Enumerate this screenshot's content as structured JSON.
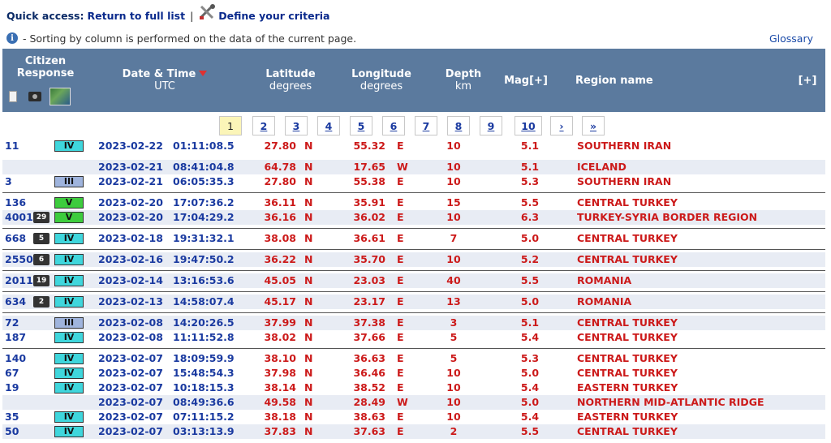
{
  "quick_access": {
    "label": "Quick access:",
    "return_link": "Return to full list",
    "separator": "|",
    "define_link": "Define your criteria"
  },
  "info": {
    "text": "- Sorting by column is performed on the data of the current page."
  },
  "glossary": "Glossary",
  "header": {
    "citizen_line1": "Citizen",
    "citizen_line2": "Response",
    "date_time": "Date & Time",
    "utc": "UTC",
    "latitude": "Latitude",
    "latitude_unit": "degrees",
    "longitude": "Longitude",
    "longitude_unit": "degrees",
    "depth": "Depth",
    "depth_unit": "km",
    "mag": "Mag[+]",
    "region": "Region name",
    "more": "[+]"
  },
  "pager": [
    "1",
    "2",
    "3",
    "4",
    "5",
    "6",
    "7",
    "8",
    "9",
    "10",
    "›",
    "»"
  ],
  "pager_current": "1",
  "colors": {
    "header_bg": "#5b7a9e",
    "intensity_II": "#4aa3e0",
    "intensity_III": "#9fb4dd",
    "intensity_IV": "#3fd6dc",
    "intensity_V": "#3dcc3d"
  },
  "rows": [
    {
      "count": "11",
      "icon": "",
      "intensity": "IV",
      "date": "2023-02-22",
      "time": "01:11:08.5",
      "lat": "27.80",
      "ns": "N",
      "lon": "55.32",
      "ew": "E",
      "depth": "10",
      "mag": "5.1",
      "region": "SOUTHERN IRAN"
    },
    {
      "count": "",
      "icon": "",
      "intensity": "",
      "date": "2023-02-21",
      "time": "08:41:04.8",
      "lat": "64.78",
      "ns": "N",
      "lon": "17.65",
      "ew": "W",
      "depth": "10",
      "mag": "5.1",
      "region": "ICELAND"
    },
    {
      "count": "3",
      "icon": "",
      "intensity": "III",
      "date": "2023-02-21",
      "time": "06:05:35.3",
      "lat": "27.80",
      "ns": "N",
      "lon": "55.38",
      "ew": "E",
      "depth": "10",
      "mag": "5.3",
      "region": "SOUTHERN IRAN"
    },
    {
      "count": "136",
      "icon": "",
      "intensity": "V",
      "date": "2023-02-20",
      "time": "17:07:36.2",
      "lat": "36.11",
      "ns": "N",
      "lon": "35.91",
      "ew": "E",
      "depth": "15",
      "mag": "5.5",
      "region": "CENTRAL TURKEY"
    },
    {
      "count": "4001",
      "icon": "29",
      "intensity": "V",
      "date": "2023-02-20",
      "time": "17:04:29.2",
      "lat": "36.16",
      "ns": "N",
      "lon": "36.02",
      "ew": "E",
      "depth": "10",
      "mag": "6.3",
      "region": "TURKEY-SYRIA BORDER REGION"
    },
    {
      "count": "668",
      "icon": "5",
      "intensity": "IV",
      "date": "2023-02-18",
      "time": "19:31:32.1",
      "lat": "38.08",
      "ns": "N",
      "lon": "36.61",
      "ew": "E",
      "depth": "7",
      "mag": "5.0",
      "region": "CENTRAL TURKEY"
    },
    {
      "count": "2550",
      "icon": "6",
      "intensity": "IV",
      "date": "2023-02-16",
      "time": "19:47:50.2",
      "lat": "36.22",
      "ns": "N",
      "lon": "35.70",
      "ew": "E",
      "depth": "10",
      "mag": "5.2",
      "region": "CENTRAL TURKEY"
    },
    {
      "count": "2011",
      "icon": "19",
      "intensity": "IV",
      "date": "2023-02-14",
      "time": "13:16:53.6",
      "lat": "45.05",
      "ns": "N",
      "lon": "23.03",
      "ew": "E",
      "depth": "40",
      "mag": "5.5",
      "region": "ROMANIA"
    },
    {
      "count": "634",
      "icon": "2",
      "intensity": "IV",
      "date": "2023-02-13",
      "time": "14:58:07.4",
      "lat": "45.17",
      "ns": "N",
      "lon": "23.17",
      "ew": "E",
      "depth": "13",
      "mag": "5.0",
      "region": "ROMANIA"
    },
    {
      "count": "72",
      "icon": "",
      "intensity": "III",
      "date": "2023-02-08",
      "time": "14:20:26.5",
      "lat": "37.99",
      "ns": "N",
      "lon": "37.38",
      "ew": "E",
      "depth": "3",
      "mag": "5.1",
      "region": "CENTRAL TURKEY"
    },
    {
      "count": "187",
      "icon": "",
      "intensity": "IV",
      "date": "2023-02-08",
      "time": "11:11:52.8",
      "lat": "38.02",
      "ns": "N",
      "lon": "37.66",
      "ew": "E",
      "depth": "5",
      "mag": "5.4",
      "region": "CENTRAL TURKEY"
    },
    {
      "count": "140",
      "icon": "",
      "intensity": "IV",
      "date": "2023-02-07",
      "time": "18:09:59.9",
      "lat": "38.10",
      "ns": "N",
      "lon": "36.63",
      "ew": "E",
      "depth": "5",
      "mag": "5.3",
      "region": "CENTRAL TURKEY"
    },
    {
      "count": "67",
      "icon": "",
      "intensity": "IV",
      "date": "2023-02-07",
      "time": "15:48:54.3",
      "lat": "37.98",
      "ns": "N",
      "lon": "36.46",
      "ew": "E",
      "depth": "10",
      "mag": "5.0",
      "region": "CENTRAL TURKEY"
    },
    {
      "count": "19",
      "icon": "",
      "intensity": "IV",
      "date": "2023-02-07",
      "time": "10:18:15.3",
      "lat": "38.14",
      "ns": "N",
      "lon": "38.52",
      "ew": "E",
      "depth": "10",
      "mag": "5.4",
      "region": "EASTERN TURKEY"
    },
    {
      "count": "",
      "icon": "",
      "intensity": "",
      "date": "2023-02-07",
      "time": "08:49:36.6",
      "lat": "49.58",
      "ns": "N",
      "lon": "28.49",
      "ew": "W",
      "depth": "10",
      "mag": "5.0",
      "region": "NORTHERN MID-ATLANTIC RIDGE"
    },
    {
      "count": "35",
      "icon": "",
      "intensity": "IV",
      "date": "2023-02-07",
      "time": "07:11:15.2",
      "lat": "38.18",
      "ns": "N",
      "lon": "38.63",
      "ew": "E",
      "depth": "10",
      "mag": "5.4",
      "region": "EASTERN TURKEY"
    },
    {
      "count": "50",
      "icon": "",
      "intensity": "IV",
      "date": "2023-02-07",
      "time": "03:13:13.9",
      "lat": "37.83",
      "ns": "N",
      "lon": "37.63",
      "ew": "E",
      "depth": "2",
      "mag": "5.5",
      "region": "CENTRAL TURKEY"
    }
  ]
}
